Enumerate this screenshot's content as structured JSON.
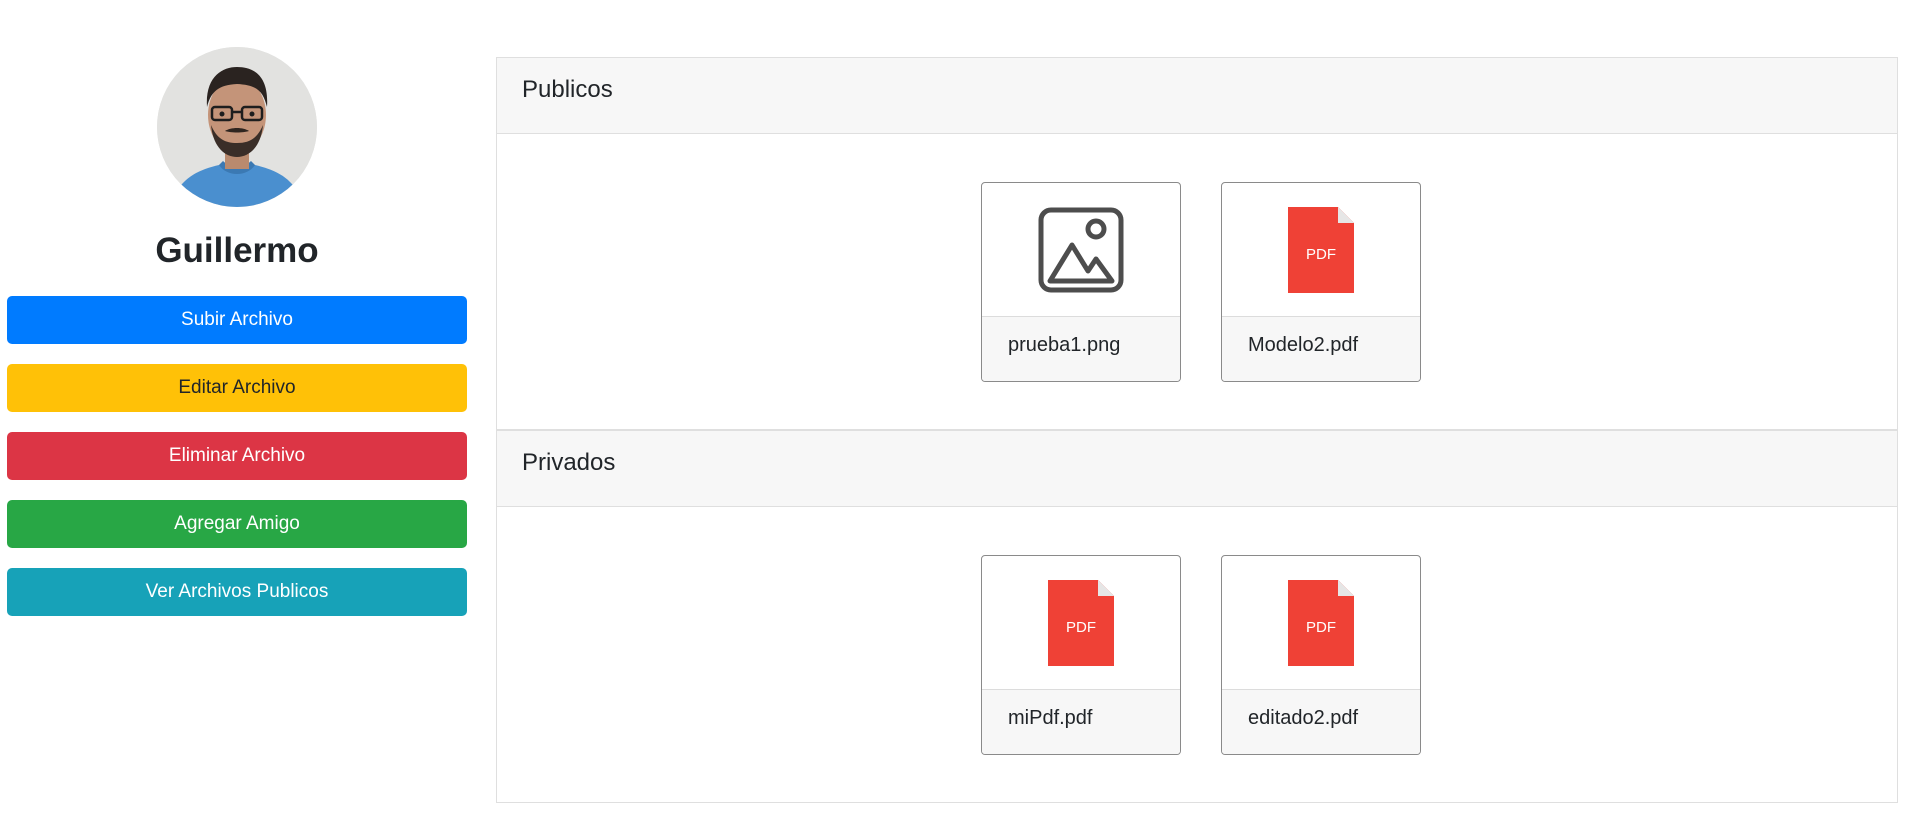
{
  "profile": {
    "name": "Guillermo",
    "avatar_icon": "profile-photo"
  },
  "actions": [
    {
      "label": "Subir Archivo",
      "color": "#007bff",
      "text_color": "#ffffff"
    },
    {
      "label": "Editar Archivo",
      "color": "#ffc107",
      "text_color": "#212529"
    },
    {
      "label": "Eliminar Archivo",
      "color": "#dc3545",
      "text_color": "#ffffff"
    },
    {
      "label": "Agregar Amigo",
      "color": "#28a745",
      "text_color": "#ffffff"
    },
    {
      "label": "Ver Archivos Publicos",
      "color": "#17a2b8",
      "text_color": "#ffffff"
    }
  ],
  "sections": {
    "public": {
      "title": "Publicos",
      "files": [
        {
          "name": "prueba1.png",
          "icon": "image-icon"
        },
        {
          "name": "Modelo2.pdf",
          "icon": "pdf-icon",
          "icon_text": "PDF"
        }
      ]
    },
    "private": {
      "title": "Privados",
      "files": [
        {
          "name": "miPdf.pdf",
          "icon": "pdf-icon",
          "icon_text": "PDF"
        },
        {
          "name": "editado2.pdf",
          "icon": "pdf-icon",
          "icon_text": "PDF"
        }
      ]
    }
  },
  "colors": {
    "pdf_red": "#ef4136",
    "pdf_fold": "#e6e6e6"
  }
}
